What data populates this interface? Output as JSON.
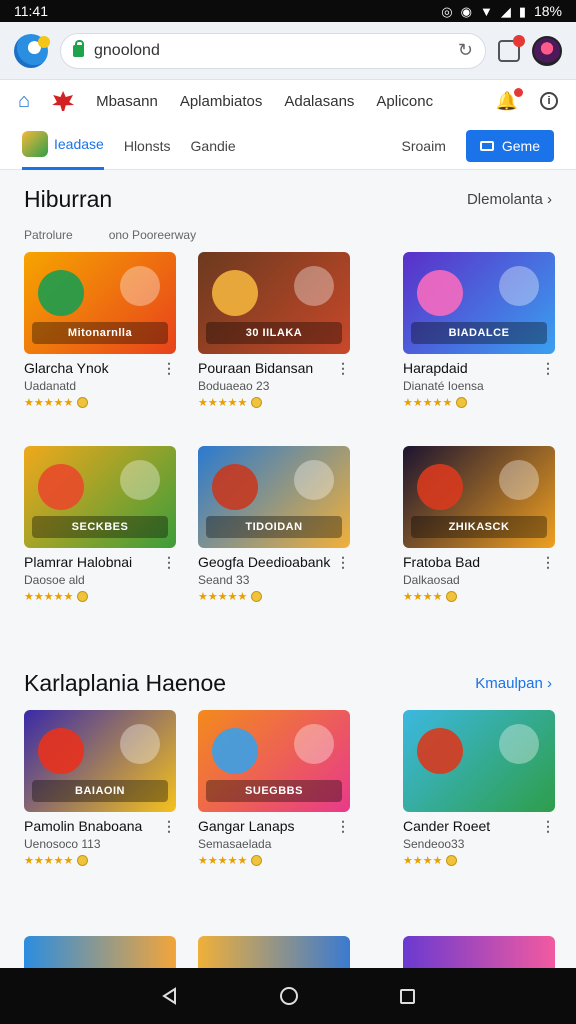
{
  "status": {
    "time": "11:41",
    "battery": "18%"
  },
  "browser": {
    "url": "gnoolond"
  },
  "nav": {
    "items": [
      "Mbasann",
      "Aplambiatos",
      "Adalasans",
      "Apliconc"
    ]
  },
  "tabs": {
    "active": "Ieadase",
    "items": [
      "Hlonsts",
      "Gandie"
    ],
    "right_link": "Sroaim",
    "game_button": "Geme"
  },
  "section1": {
    "title": "Hiburran",
    "more": "Dlemolanta",
    "sub_left": "Patrolure",
    "sub_right": "ono Pooreerway",
    "cards": [
      {
        "title": "Glarcha Ynok",
        "subtitle": "Uadanatd",
        "stars": "★★★★★",
        "banner": "Mitonarnlla",
        "colors": [
          "#f6a400",
          "#e8421c",
          "#1c9c4e"
        ]
      },
      {
        "title": "Pouraan Bidansan",
        "subtitle": "Boduaeao 23",
        "stars": "★★★★★",
        "banner": "30 IILAKA",
        "colors": [
          "#6b3a1e",
          "#c9482a",
          "#f3b33d"
        ]
      },
      {
        "title": "Harapdaid",
        "subtitle": "Dianaté Ioensa",
        "stars": "★★★★★",
        "banner": "BIADALCE",
        "colors": [
          "#5a2fc9",
          "#3aa0f0",
          "#f56ac0"
        ]
      },
      {
        "title": "Plamrar Halobnai",
        "subtitle": "Daosoe ald",
        "stars": "★★★★★",
        "banner": "SECKBES",
        "colors": [
          "#f0a81c",
          "#3c9d3a",
          "#e84a2a"
        ]
      },
      {
        "title": "Geogfa Deedioabank",
        "subtitle": "Seand 33",
        "stars": "★★★★★",
        "banner": "TIDOIDAN",
        "colors": [
          "#2a7ad0",
          "#f2b03a",
          "#c63a20"
        ]
      },
      {
        "title": "Fratoba Bad",
        "subtitle": "Dalkaosad",
        "stars": "★★★★",
        "banner": "ZHIKASCK",
        "colors": [
          "#1c1430",
          "#f0a020",
          "#d83a1e"
        ]
      }
    ]
  },
  "section2": {
    "title": "Karlaplania Haenoe",
    "more": "Kmaulpan",
    "cards": [
      {
        "title": "Pamolin Bnaboana",
        "subtitle": "Uenosoco 113",
        "stars": "★★★★★",
        "banner": "BAIAOIN",
        "colors": [
          "#3a2aa8",
          "#f5c21c",
          "#e8321e"
        ]
      },
      {
        "title": "Gangar Lanaps",
        "subtitle": "Semasaelada",
        "stars": "★★★★★",
        "banner": "SUEGBBS",
        "colors": [
          "#f38a1c",
          "#e83a8a",
          "#3aa0e8"
        ]
      },
      {
        "title": "Cander Roeet",
        "subtitle": "Sendeoo33",
        "stars": "★★★★",
        "banner": "",
        "colors": [
          "#3cb8e0",
          "#2e9e4a",
          "#d8381e"
        ]
      }
    ]
  }
}
